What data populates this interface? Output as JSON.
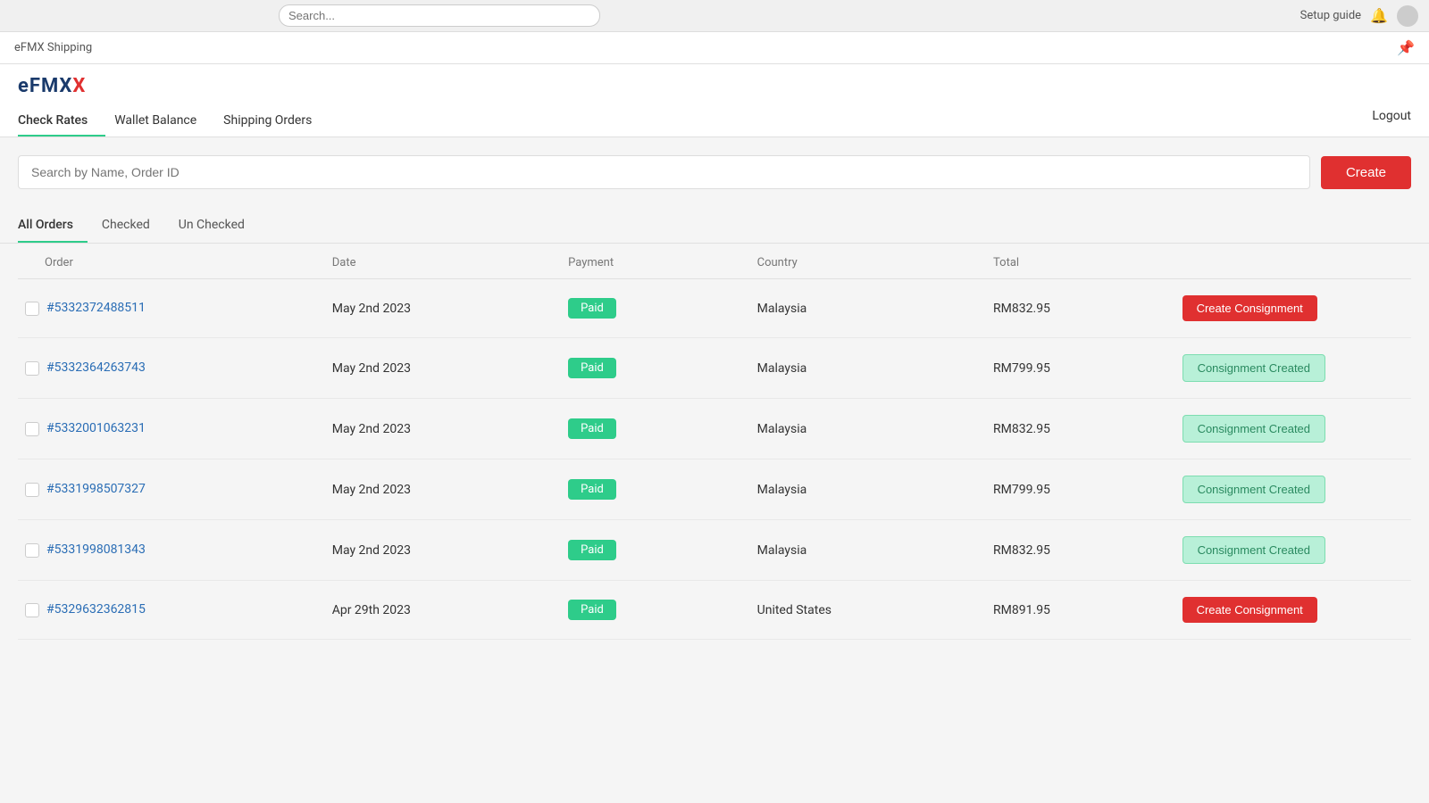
{
  "browser": {
    "url_placeholder": "Search...",
    "user_label": "Setup guide",
    "notification_icon": "bell-icon",
    "avatar_icon": "avatar-icon"
  },
  "app": {
    "title": "eFMX Shipping",
    "pin_icon": "pin-icon"
  },
  "logo": {
    "text_main": "eFMX",
    "text_x": "X"
  },
  "nav": {
    "items": [
      {
        "label": "Check Rates",
        "active": true
      },
      {
        "label": "Wallet Balance",
        "active": false
      },
      {
        "label": "Shipping Orders",
        "active": false
      }
    ],
    "logout_label": "Logout"
  },
  "search": {
    "placeholder": "Search by Name, Order ID",
    "create_label": "Create"
  },
  "tabs": [
    {
      "label": "All Orders",
      "active": true
    },
    {
      "label": "Checked",
      "active": false
    },
    {
      "label": "Un Checked",
      "active": false
    }
  ],
  "table": {
    "columns": [
      "Order",
      "Date",
      "Payment",
      "Country",
      "Total",
      ""
    ],
    "rows": [
      {
        "id": "#5332372488511",
        "date": "May 2nd 2023",
        "payment": "Paid",
        "country": "Malaysia",
        "total": "RM832.95",
        "action_type": "create",
        "action_label": "Create Consignment",
        "checked": false
      },
      {
        "id": "#5332364263743",
        "date": "May 2nd 2023",
        "payment": "Paid",
        "country": "Malaysia",
        "total": "RM799.95",
        "action_type": "created",
        "action_label": "Consignment Created",
        "checked": false
      },
      {
        "id": "#5332001063231",
        "date": "May 2nd 2023",
        "payment": "Paid",
        "country": "Malaysia",
        "total": "RM832.95",
        "action_type": "created",
        "action_label": "Consignment Created",
        "checked": false
      },
      {
        "id": "#5331998507327",
        "date": "May 2nd 2023",
        "payment": "Paid",
        "country": "Malaysia",
        "total": "RM799.95",
        "action_type": "created",
        "action_label": "Consignment Created",
        "checked": false
      },
      {
        "id": "#5331998081343",
        "date": "May 2nd 2023",
        "payment": "Paid",
        "country": "Malaysia",
        "total": "RM832.95",
        "action_type": "created",
        "action_label": "Consignment Created",
        "checked": false
      },
      {
        "id": "#5329632362815",
        "date": "Apr 29th 2023",
        "payment": "Paid",
        "country": "United States",
        "total": "RM891.95",
        "action_type": "create",
        "action_label": "Create Consignment",
        "checked": false
      }
    ]
  },
  "colors": {
    "accent_green": "#2ecc8a",
    "accent_red": "#e03030",
    "created_bg": "#b8f0d8",
    "created_border": "#7dddb0",
    "created_text": "#2a8a60",
    "order_link": "#2a6db5"
  }
}
